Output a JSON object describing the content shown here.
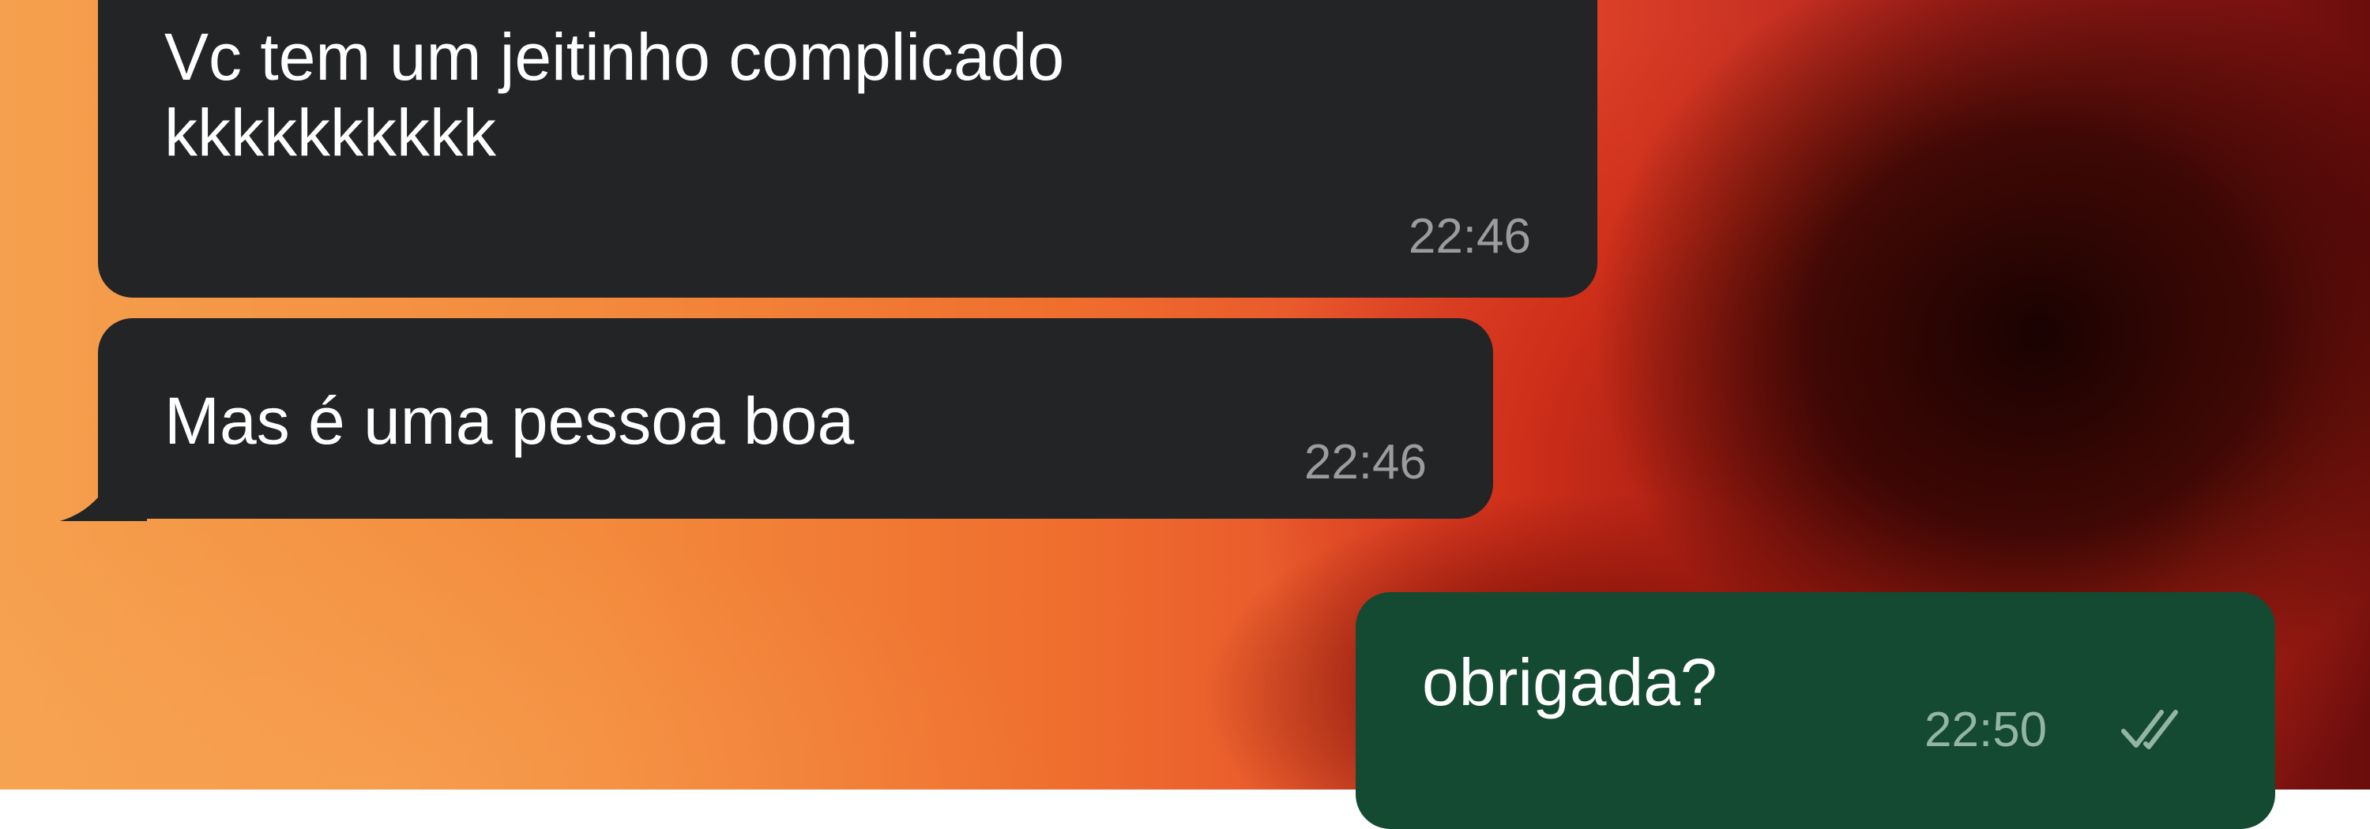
{
  "messages": [
    {
      "direction": "incoming",
      "text": "Vc tem um jeitinho complicado\nkkkkkkkkkk",
      "time": "22:46"
    },
    {
      "direction": "incoming",
      "text": "Mas é uma pessoa boa",
      "time": "22:46"
    },
    {
      "direction": "outgoing",
      "text": "obrigada?",
      "time": "22:50",
      "status_icon": "double-check-read-icon"
    }
  ],
  "colors": {
    "incoming_bubble": "#232426",
    "outgoing_bubble": "#144a31",
    "incoming_time": "#9c9c9e",
    "outgoing_time": "#93b5a2"
  }
}
